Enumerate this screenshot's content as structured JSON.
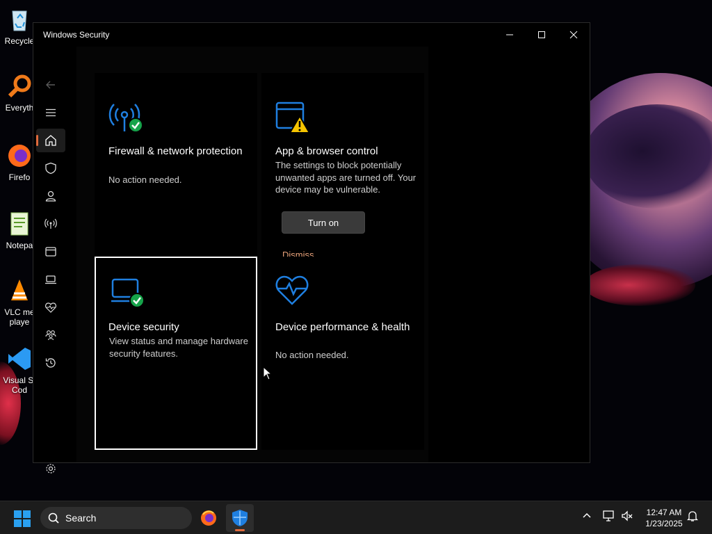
{
  "desktop": {
    "icons": [
      {
        "label": "Recycle",
        "icon": "recycle-bin-icon"
      },
      {
        "label": "Everyth",
        "icon": "everything-search-icon"
      },
      {
        "label": "Firefo",
        "icon": "firefox-icon"
      },
      {
        "label": "Notepa",
        "icon": "notepad-icon"
      },
      {
        "label": "VLC me\nplaye",
        "icon": "vlc-icon"
      },
      {
        "label": "Visual St\nCod",
        "icon": "vscode-icon"
      }
    ]
  },
  "window": {
    "title": "Windows Security",
    "controls": {
      "minimize": "—",
      "maximize": "☐",
      "close": "✕"
    }
  },
  "nav": {
    "items": [
      {
        "name": "back",
        "icon": "back-arrow-icon"
      },
      {
        "name": "menu",
        "icon": "hamburger-menu-icon"
      },
      {
        "name": "home",
        "icon": "home-icon",
        "selected": true
      },
      {
        "name": "virus-protection",
        "icon": "shield-icon"
      },
      {
        "name": "account-protection",
        "icon": "person-icon"
      },
      {
        "name": "firewall",
        "icon": "antenna-icon"
      },
      {
        "name": "app-browser",
        "icon": "browser-window-icon"
      },
      {
        "name": "device-security",
        "icon": "laptop-icon"
      },
      {
        "name": "device-performance",
        "icon": "heart-pulse-icon"
      },
      {
        "name": "family-options",
        "icon": "family-icon"
      },
      {
        "name": "protection-history",
        "icon": "history-icon"
      },
      {
        "name": "settings",
        "icon": "gear-icon"
      }
    ]
  },
  "tiles": {
    "firewall": {
      "title": "Firewall & network protection",
      "status": "No action needed."
    },
    "app_browser": {
      "title": "App & browser control",
      "status": "The settings to block potentially unwanted apps are turned off. Your device may be vulnerable.",
      "primary_button": "Turn on",
      "link": "Dismiss"
    },
    "device_security": {
      "title": "Device security",
      "status": "View status and manage hardware security features."
    },
    "device_performance": {
      "title": "Device performance & health",
      "status": "No action needed."
    }
  },
  "taskbar": {
    "search_placeholder": "Search",
    "apps": [
      {
        "name": "firefox",
        "icon": "firefox-icon"
      },
      {
        "name": "windows-security",
        "icon": "windows-security-shield-icon",
        "active": true
      }
    ],
    "tray": [
      "chevron-up-icon",
      "network-icon",
      "volume-muted-icon"
    ],
    "time": "12:47 AM",
    "date": "1/23/2025",
    "notification_icon": "bell-icon"
  },
  "colors": {
    "accent": "#e06a3c",
    "icon_blue": "#1f7fe0",
    "ok_green": "#16a34a",
    "warn_yellow": "#f5c400",
    "link": "#e8a27a"
  }
}
